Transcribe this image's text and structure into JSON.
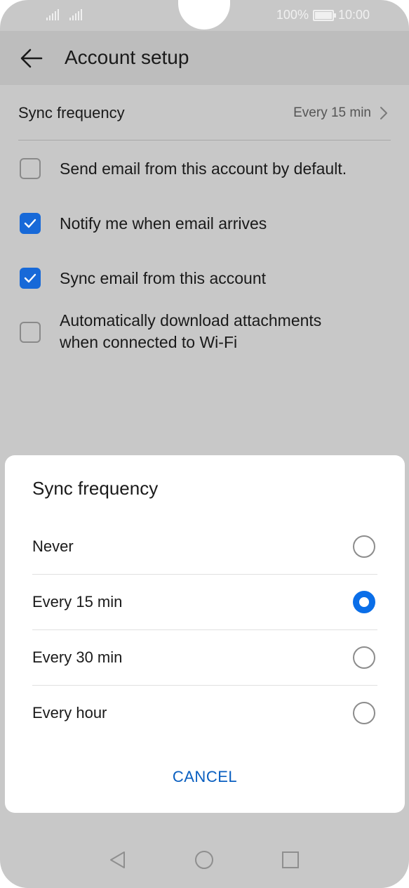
{
  "status": {
    "battery": "100%",
    "time": "10:00"
  },
  "header": {
    "title": "Account setup"
  },
  "settings": {
    "sync_frequency": {
      "label": "Sync frequency",
      "value": "Every 15 min"
    },
    "checkboxes": [
      {
        "label": "Send email from this account by default.",
        "checked": false
      },
      {
        "label": "Notify me when email arrives",
        "checked": true
      },
      {
        "label": "Sync email from this account",
        "checked": true
      },
      {
        "label_line1": "Automatically download attachments",
        "label_line2": "when connected to Wi-Fi",
        "checked": false
      }
    ]
  },
  "dialog": {
    "title": "Sync frequency",
    "options": [
      {
        "label": "Never",
        "selected": false
      },
      {
        "label": "Every 15 min",
        "selected": true
      },
      {
        "label": "Every 30 min",
        "selected": false
      },
      {
        "label": "Every hour",
        "selected": false
      }
    ],
    "cancel_label": "CANCEL"
  },
  "icons": {
    "back": "arrow-left-icon",
    "chevron": "chevron-right-icon",
    "check": "check-icon",
    "nav_back": "triangle-back-icon",
    "nav_home": "circle-home-icon",
    "nav_recents": "square-recents-icon"
  },
  "colors": {
    "accent": "#1769d8",
    "radio_selected": "#0a6ee8",
    "cancel_text": "#0a5fc0"
  }
}
